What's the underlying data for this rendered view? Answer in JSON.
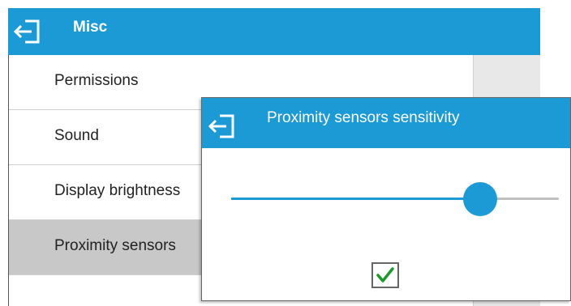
{
  "screen": {
    "title": "Misc",
    "items": [
      {
        "label": "Permissions"
      },
      {
        "label": "Sound"
      },
      {
        "label": "Display brightness"
      },
      {
        "label": "Proximity sensors",
        "selected": true
      }
    ]
  },
  "dialog": {
    "title": "Proximity sensors sensitivity",
    "slider_value": 0.76
  },
  "colors": {
    "accent": "#1b9ad6",
    "selected": "#c8c8c8",
    "confirm_check": "#1c9a2c"
  },
  "icons": {
    "back": "back-arrow-icon",
    "confirm": "checkmark-icon"
  }
}
